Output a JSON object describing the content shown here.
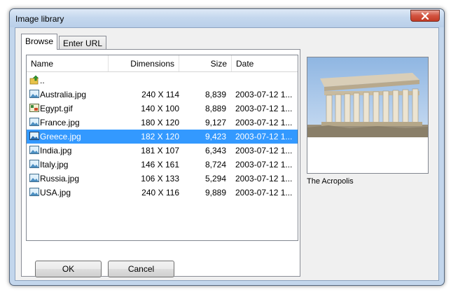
{
  "window": {
    "title": "Image library"
  },
  "tabs": [
    {
      "label": "Browse",
      "active": true
    },
    {
      "label": "Enter URL",
      "active": false
    }
  ],
  "columns": {
    "name": "Name",
    "dimensions": "Dimensions",
    "size": "Size",
    "date": "Date"
  },
  "files": [
    {
      "icon": "parent-folder-icon",
      "name": "..",
      "dimensions": "",
      "size": "",
      "date": ""
    },
    {
      "icon": "image-file-icon",
      "name": "Australia.jpg",
      "dimensions": "240 X 114",
      "size": "8,839",
      "date": "2003-07-12 1..."
    },
    {
      "icon": "gif-file-icon",
      "name": "Egypt.gif",
      "dimensions": "140 X 100",
      "size": "8,889",
      "date": "2003-07-12 1..."
    },
    {
      "icon": "image-file-icon",
      "name": "France.jpg",
      "dimensions": "180 X 120",
      "size": "9,127",
      "date": "2003-07-12 1..."
    },
    {
      "icon": "image-file-icon",
      "name": "Greece.jpg",
      "dimensions": "182 X 120",
      "size": "9,423",
      "date": "2003-07-12 1...",
      "selected": true
    },
    {
      "icon": "image-file-icon",
      "name": "India.jpg",
      "dimensions": "181 X 107",
      "size": "6,343",
      "date": "2003-07-12 1..."
    },
    {
      "icon": "image-file-icon",
      "name": "Italy.jpg",
      "dimensions": "146 X 161",
      "size": "8,724",
      "date": "2003-07-12 1..."
    },
    {
      "icon": "image-file-icon",
      "name": "Russia.jpg",
      "dimensions": "106 X 133",
      "size": "5,294",
      "date": "2003-07-12 1..."
    },
    {
      "icon": "image-file-icon",
      "name": "USA.jpg",
      "dimensions": "240 X 116",
      "size": "9,889",
      "date": "2003-07-12 1..."
    }
  ],
  "buttons": {
    "ok": "OK",
    "cancel": "Cancel"
  },
  "preview": {
    "caption": "The Acropolis"
  },
  "colors": {
    "selection": "#3399ff",
    "close_button": "#c9442f",
    "frame": "#c3d6ec"
  }
}
